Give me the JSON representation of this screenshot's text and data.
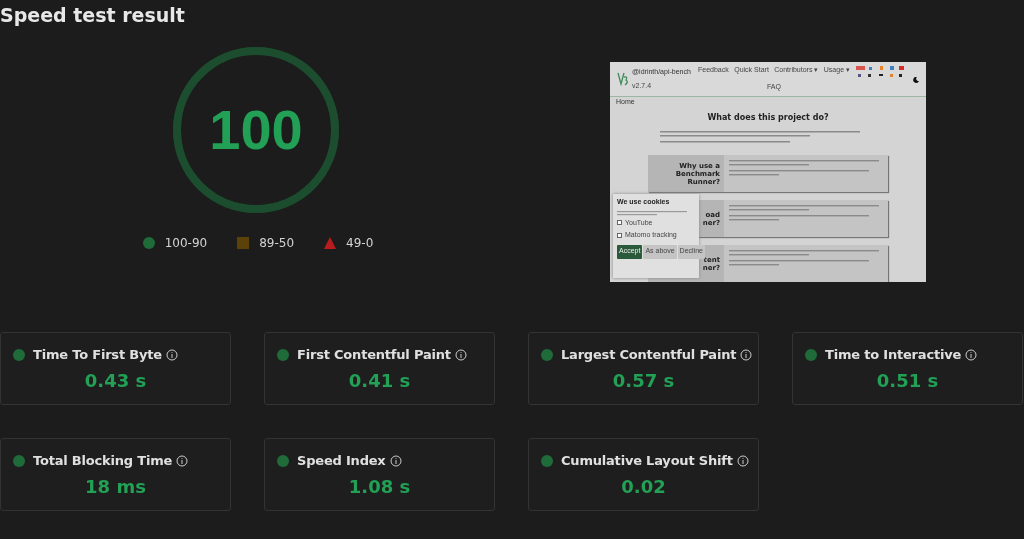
{
  "title": "Speed test result",
  "score": {
    "value": "100",
    "level": 1,
    "color": "#22a055"
  },
  "legend": [
    {
      "kind": "circle",
      "label": "100-90",
      "color": "#1f6b3a"
    },
    {
      "kind": "square",
      "label": "89-50",
      "color": "#5c4208"
    },
    {
      "kind": "triangle",
      "label": "49-0",
      "color": "#b91c1c"
    }
  ],
  "preview": {
    "site_name": "@idrinth/api-bench",
    "version": "v2.7.4",
    "nav": [
      "Feedback",
      "Quick Start",
      "Contributors ▾",
      "Usage ▾",
      "FAQ"
    ],
    "breadcrumb": "Home",
    "heading": "What does this project do?",
    "cards": [
      {
        "title": [
          "Why use a",
          "Benchmark",
          "Runner?"
        ]
      },
      {
        "title": [
          "oad",
          "ner?"
        ]
      },
      {
        "title": [
          "tent",
          "ner?"
        ]
      }
    ],
    "cookie": {
      "title": "We use cookies",
      "options": [
        {
          "label": "YouTube",
          "checked": false
        },
        {
          "label": "Matomo tracking",
          "checked": false
        }
      ],
      "buttons": [
        {
          "label": "Accept",
          "kind": "primary"
        },
        {
          "label": "As above",
          "kind": "secondary"
        },
        {
          "label": "Decline",
          "kind": "secondary"
        }
      ]
    }
  },
  "metrics": [
    {
      "label": "Time To First Byte",
      "value": "0.43 s",
      "color": "#1f6b3a"
    },
    {
      "label": "First Contentful Paint",
      "value": "0.41 s",
      "color": "#1f6b3a"
    },
    {
      "label": "Largest Contentful Paint",
      "value": "0.57 s",
      "color": "#1f6b3a"
    },
    {
      "label": "Time to Interactive",
      "value": "0.51 s",
      "color": "#1f6b3a"
    },
    {
      "label": "Total Blocking Time",
      "value": "18 ms",
      "color": "#1f6b3a"
    },
    {
      "label": "Speed Index",
      "value": "1.08 s",
      "color": "#1f6b3a"
    },
    {
      "label": "Cumulative Layout Shift",
      "value": "0.02",
      "color": "#1f6b3a"
    }
  ]
}
